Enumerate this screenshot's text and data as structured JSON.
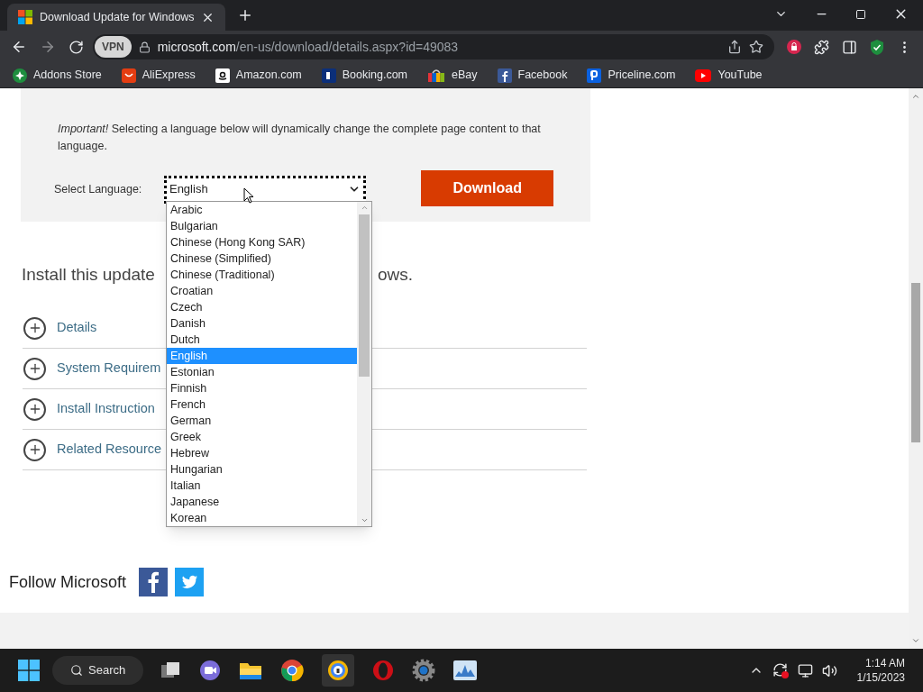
{
  "browser": {
    "tab": {
      "title": "Download Update for Windows",
      "selected": true
    },
    "address": {
      "vpn": "VPN",
      "domain": "microsoft.com",
      "path": "/en-us/download/details.aspx?id=49083"
    },
    "bookmarks": [
      "Addons Store",
      "AliExpress",
      "Amazon.com",
      "Booking.com",
      "eBay",
      "Facebook",
      "Priceline.com",
      "YouTube"
    ]
  },
  "page": {
    "notice": "*Important!* Selecting a language below will dynamically change the complete page content to that language.",
    "select_label": "Select Language:",
    "select": {
      "value": "English",
      "expanded": true
    },
    "download_button": "Download",
    "options": [
      {
        "label": "Arabic",
        "selected": false
      },
      {
        "label": "Bulgarian",
        "selected": false
      },
      {
        "label": "Chinese (Hong Kong SAR)",
        "selected": false
      },
      {
        "label": "Chinese (Simplified)",
        "selected": false
      },
      {
        "label": "Chinese (Traditional)",
        "selected": false
      },
      {
        "label": "Croatian",
        "selected": false
      },
      {
        "label": "Czech",
        "selected": false
      },
      {
        "label": "Danish",
        "selected": false
      },
      {
        "label": "Dutch",
        "selected": false
      },
      {
        "label": "English",
        "selected": true
      },
      {
        "label": "Estonian",
        "selected": false
      },
      {
        "label": "Finnish",
        "selected": false
      },
      {
        "label": "French",
        "selected": false
      },
      {
        "label": "German",
        "selected": false
      },
      {
        "label": "Greek",
        "selected": false
      },
      {
        "label": "Hebrew",
        "selected": false
      },
      {
        "label": "Hungarian",
        "selected": false
      },
      {
        "label": "Italian",
        "selected": false
      },
      {
        "label": "Japanese",
        "selected": false
      },
      {
        "label": "Korean",
        "selected": false
      }
    ],
    "heading_start": "Install this update",
    "heading_end": "ows.",
    "sections": [
      {
        "label": "Details",
        "expanded": false
      },
      {
        "label": "System Requirem",
        "expanded": false
      },
      {
        "label": "Install Instruction",
        "expanded": false
      },
      {
        "label": "Related Resource",
        "expanded": false
      }
    ],
    "follow": "Follow Microsoft"
  },
  "taskbar": {
    "search": "Search",
    "time": "1:14 AM",
    "date": "1/15/2023"
  }
}
